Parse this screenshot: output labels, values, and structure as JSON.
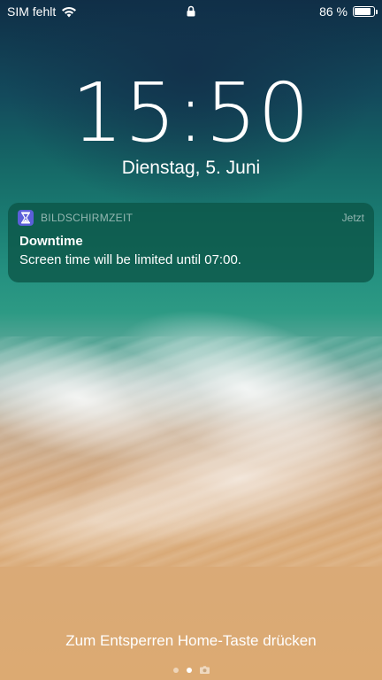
{
  "status_bar": {
    "carrier": "SIM fehlt",
    "battery_text": "86 %",
    "battery_level": 0.86,
    "icons": [
      "wifi-icon",
      "lock-icon",
      "battery-icon"
    ]
  },
  "lock_screen": {
    "time": "15:50",
    "date": "Dienstag, 5. Juni",
    "unlock_hint": "Zum Entsperren Home-Taste drücken",
    "pages": [
      "dot",
      "dot-active",
      "camera-icon"
    ]
  },
  "notification": {
    "app_name": "BILDSCHIRMZEIT",
    "time": "Jetzt",
    "title": "Downtime",
    "body": "Screen time will be limited until 07:00.",
    "icon": "hourglass-icon",
    "app_icon_color": "#5b5fd9"
  }
}
